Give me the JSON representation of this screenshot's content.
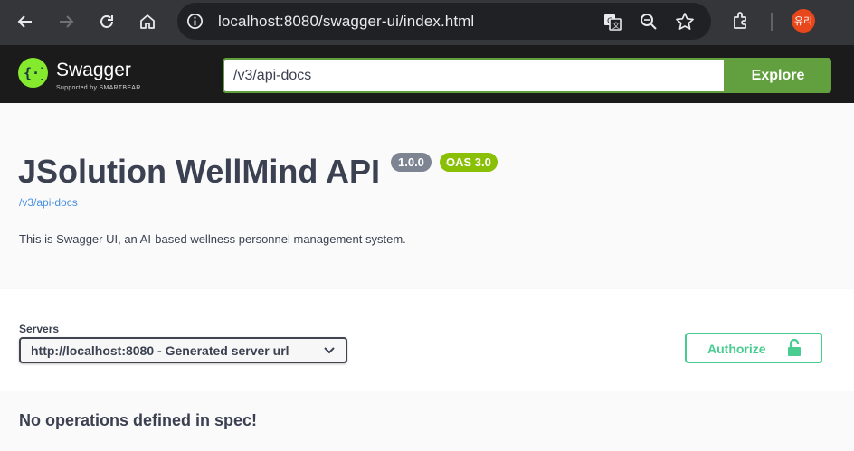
{
  "browser": {
    "url": "localhost:8080/swagger-ui/index.html",
    "profile_initials": "유리",
    "profile_color": "#e8461b"
  },
  "topbar": {
    "brand": "Swagger",
    "brand_sub": "Supported by SMARTBEAR",
    "spec_url": "/v3/api-docs",
    "explore_label": "Explore",
    "accent_color": "#62a03f"
  },
  "info": {
    "title": "JSolution WellMind API",
    "version_badge": "1.0.0",
    "oas_badge": "OAS 3.0",
    "spec_link": "/v3/api-docs",
    "description": "This is Swagger UI, an AI-based wellness personnel management system."
  },
  "servers": {
    "label": "Servers",
    "selected": "http://localhost:8080 - Generated server url"
  },
  "authorize": {
    "label": "Authorize",
    "color": "#49cc90"
  },
  "operations": {
    "empty_message": "No operations defined in spec!"
  }
}
